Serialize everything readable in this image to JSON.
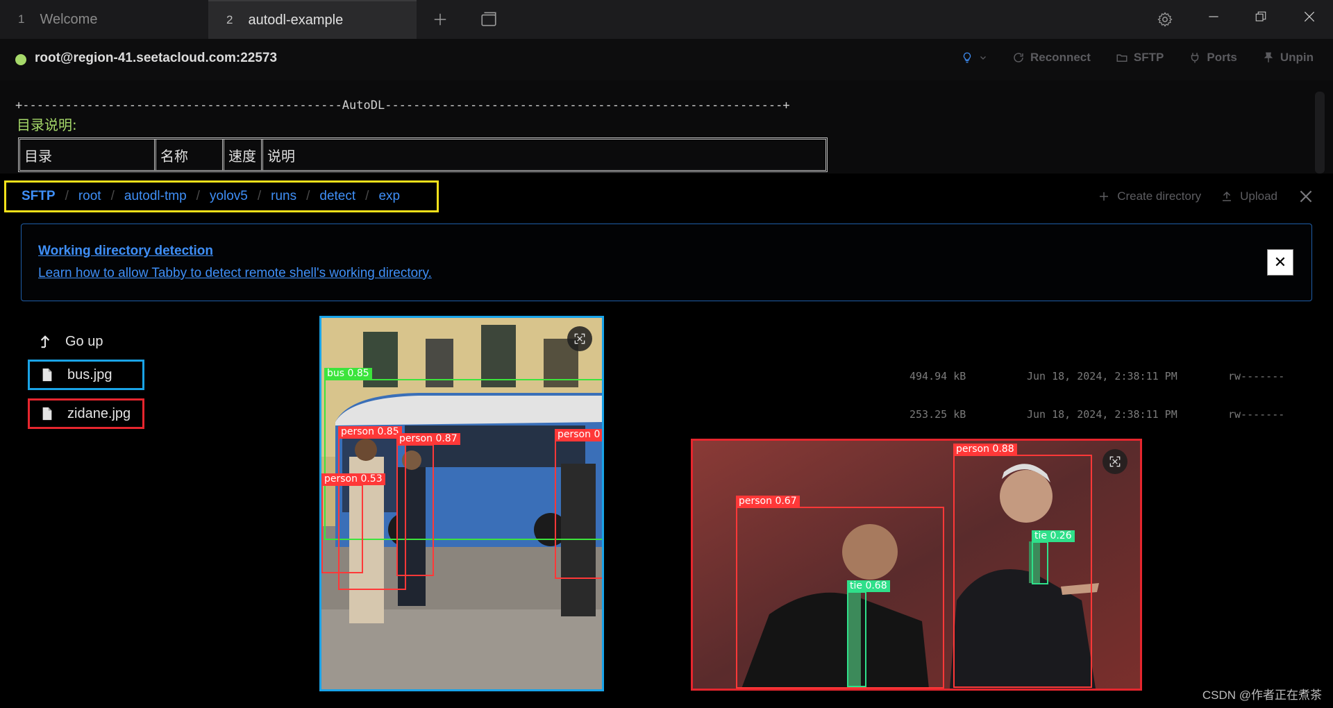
{
  "tabs": [
    {
      "num": "1",
      "label": "Welcome"
    },
    {
      "num": "2",
      "label": "autodl-example"
    }
  ],
  "host": "root@region-41.seetacloud.com:22573",
  "host_actions": [
    "Reconnect",
    "SFTP",
    "Ports",
    "Unpin"
  ],
  "terminal": {
    "rule": "+---------------------------------------------AutoDL--------------------------------------------------------+",
    "dir_title": "目录说明:",
    "table_headers": [
      "目录",
      "名称",
      "速度",
      "说明"
    ]
  },
  "sftp": {
    "breadcrumbs": [
      "SFTP",
      "root",
      "autodl-tmp",
      "yolov5",
      "runs",
      "detect",
      "exp"
    ],
    "create_dir_label": "Create directory",
    "upload_label": "Upload",
    "notice_title": "Working directory detection",
    "notice_link": "Learn how to allow Tabby to detect remote shell's working directory.",
    "go_up_label": "Go up",
    "files": [
      {
        "name": "bus.jpg",
        "size": "494.94 kB",
        "modified": "Jun 18, 2024, 2:38:11 PM",
        "mode": "rw-------"
      },
      {
        "name": "zidane.jpg",
        "size": "253.25 kB",
        "modified": "Jun 18, 2024, 2:38:11 PM",
        "mode": "rw-------"
      }
    ]
  },
  "detections": {
    "bus": [
      {
        "label": "bus 0.85"
      },
      {
        "label": "person 0.85"
      },
      {
        "label": "person 0.87"
      },
      {
        "label": "person 0.53"
      },
      {
        "label": "person 0"
      }
    ],
    "zidane": [
      {
        "label": "person 0.88"
      },
      {
        "label": "person 0.67"
      },
      {
        "label": "tie 0.26"
      },
      {
        "label": "tie 0.68"
      }
    ]
  },
  "watermark": "CSDN @作者正在煮茶",
  "colors": {
    "accent": "#3f8ff7",
    "status_online": "#a6d96a",
    "highlight_yellow": "#f6e11a",
    "highlight_blue": "#19a3e8",
    "highlight_red": "#e6262e"
  }
}
